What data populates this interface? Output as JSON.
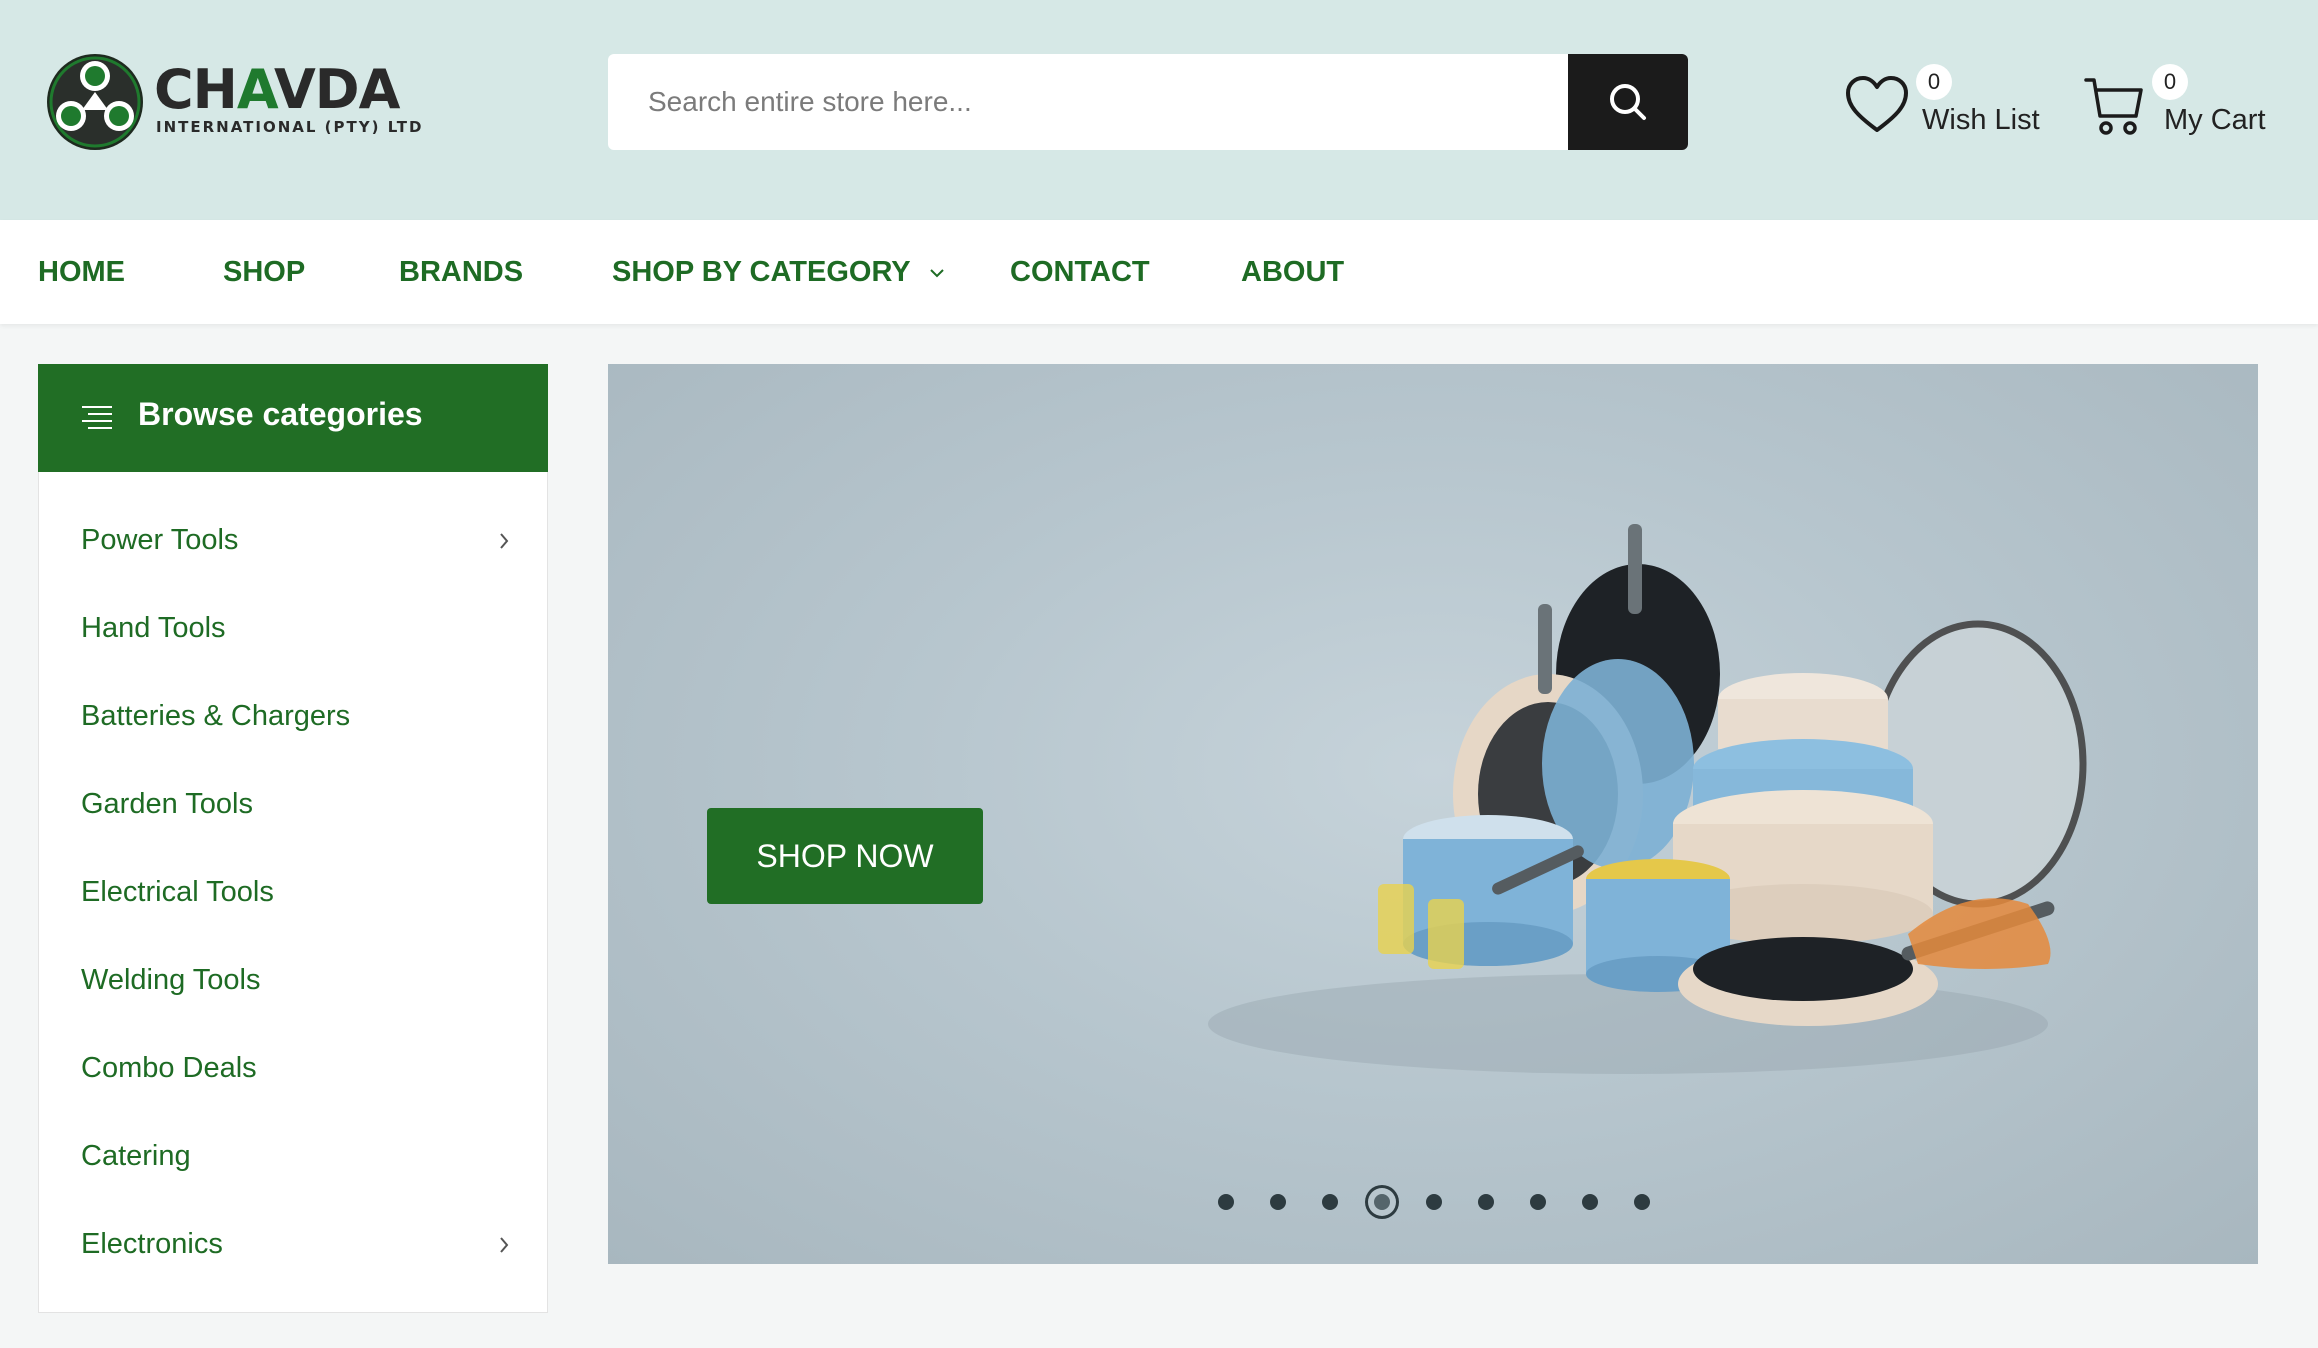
{
  "brand": {
    "name_part1": "CH",
    "name_part2": "A",
    "name_part3": "VDA",
    "tagline": "INTERNATIONAL (PTY) LTD",
    "accent": "#216e25"
  },
  "search": {
    "placeholder": "Search entire store here..."
  },
  "wishlist": {
    "label": "Wish List",
    "count": "0"
  },
  "cart": {
    "label": "My Cart",
    "count": "0"
  },
  "nav": [
    {
      "label": "HOME"
    },
    {
      "label": "SHOP"
    },
    {
      "label": "BRANDS"
    },
    {
      "label": "SHOP BY CATEGORY"
    },
    {
      "label": "CONTACT"
    },
    {
      "label": "ABOUT"
    }
  ],
  "sidebar": {
    "title": "Browse categories",
    "items": [
      {
        "label": "Power Tools",
        "has_submenu": true
      },
      {
        "label": "Hand Tools",
        "has_submenu": false
      },
      {
        "label": "Batteries & Chargers",
        "has_submenu": false
      },
      {
        "label": "Garden Tools",
        "has_submenu": false
      },
      {
        "label": "Electrical Tools",
        "has_submenu": false
      },
      {
        "label": "Welding Tools",
        "has_submenu": false
      },
      {
        "label": "Combo Deals",
        "has_submenu": false
      },
      {
        "label": "Catering",
        "has_submenu": false
      },
      {
        "label": "Electronics",
        "has_submenu": true
      }
    ]
  },
  "banner": {
    "cta_label": "SHOP NOW",
    "slide_count": 9,
    "active_slide": 4
  }
}
